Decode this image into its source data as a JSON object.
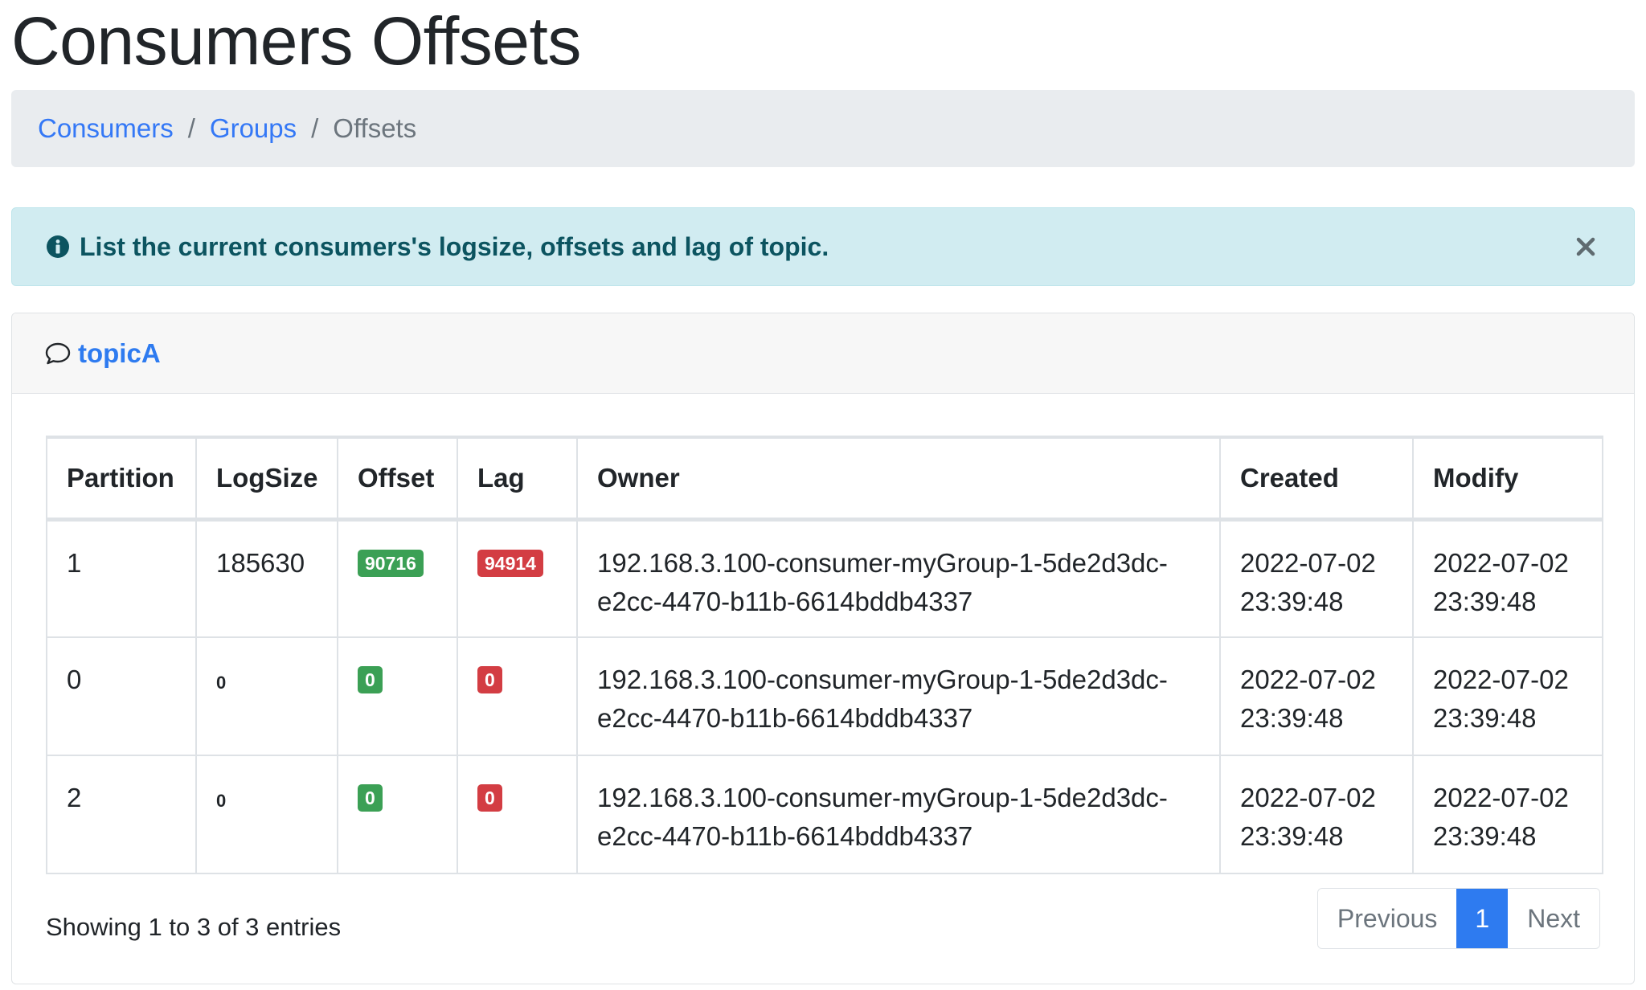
{
  "header": {
    "title": "Consumers Offsets"
  },
  "breadcrumb": {
    "items": [
      {
        "label": "Consumers"
      },
      {
        "label": "Groups"
      }
    ],
    "separator": "/",
    "active": "Offsets"
  },
  "alert": {
    "icon": "info-circle-icon",
    "message": "List the current consumers's logsize, offsets and lag of topic.",
    "close_icon": "close-icon"
  },
  "card": {
    "icon": "comment-icon",
    "topic": "topicA"
  },
  "table": {
    "columns": [
      "Partition",
      "LogSize",
      "Offset",
      "Lag",
      "Owner",
      "Created",
      "Modify"
    ],
    "rows": [
      {
        "partition": "1",
        "logsize": "185630",
        "offset": "90716",
        "lag": "94914",
        "owner_line1": "192.168.3.100-consumer-myGroup-1-5de2d3dc-",
        "owner_line2": "e2cc-4470-b11b-6614bddb4337",
        "created_date": "2022-07-02",
        "created_time": "23:39:48",
        "modify_date": "2022-07-02",
        "modify_time": "23:39:48"
      },
      {
        "partition": "0",
        "logsize": "0",
        "offset": "0",
        "lag": "0",
        "owner_line1": "192.168.3.100-consumer-myGroup-1-5de2d3dc-",
        "owner_line2": "e2cc-4470-b11b-6614bddb4337",
        "created_date": "2022-07-02",
        "created_time": "23:39:48",
        "modify_date": "2022-07-02",
        "modify_time": "23:39:48"
      },
      {
        "partition": "2",
        "logsize": "0",
        "offset": "0",
        "lag": "0",
        "owner_line1": "192.168.3.100-consumer-myGroup-1-5de2d3dc-",
        "owner_line2": "e2cc-4470-b11b-6614bddb4337",
        "created_date": "2022-07-02",
        "created_time": "23:39:48",
        "modify_date": "2022-07-02",
        "modify_time": "23:39:48"
      }
    ]
  },
  "footer": {
    "info": "Showing 1 to 3 of 3 entries",
    "pagination": {
      "previous": "Previous",
      "current": "1",
      "next": "Next"
    }
  },
  "colors": {
    "link": "#2e7bf0",
    "alert_bg": "#d1ecf1",
    "alert_text": "#0c5460",
    "badge_success": "#3ba055",
    "badge_danger": "#d33d43",
    "breadcrumb_bg": "#e9ecef"
  }
}
